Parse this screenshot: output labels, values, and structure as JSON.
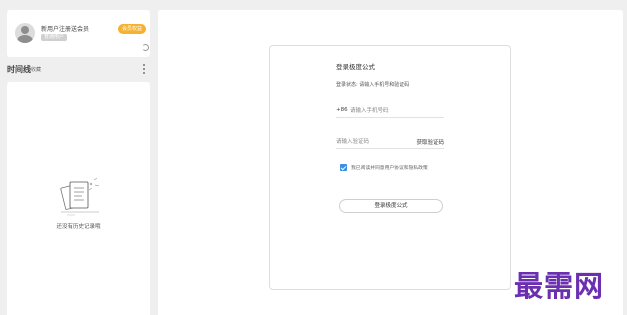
{
  "user_card": {
    "promo_text": "新用户注册送会员",
    "sub_tag": "普通用户",
    "vip_badge": "会员权益",
    "refresh_icon": "refresh-icon"
  },
  "timeline": {
    "title": "时间线",
    "subtitle": "收藏",
    "more_icon": "more-vertical-icon",
    "empty_text": "还没有历史记录哦"
  },
  "login": {
    "title": "登录极度公式",
    "subtitle": "登录状态: 请输入手机号和验证码",
    "country_code": "+86",
    "phone_placeholder": "请输入手机号码",
    "code_placeholder": "请输入验证码",
    "get_code_label": "获取验证码",
    "agree_text": "我已阅读并同意用户协议和隐私政策",
    "agree_checked": true,
    "submit_label": "登录极度公式"
  },
  "watermark": "最需网",
  "colors": {
    "background": "#efeff0",
    "vip_badge": "#f6b12f",
    "checkbox": "#3a8ee6",
    "watermark": "#6b2fb0"
  }
}
